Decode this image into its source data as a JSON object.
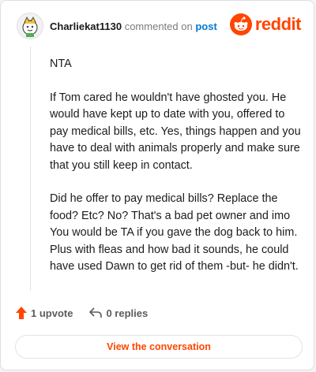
{
  "comment": {
    "username": "Charliekat1130",
    "action_text": "commented on",
    "link_text": "post",
    "paragraphs": [
      "NTA",
      "If Tom cared he wouldn't have ghosted you. He would have kept up to date with you, offered to pay medical bills, etc. Yes, things happen and you have to deal with animals properly and make sure that you still keep in contact.",
      "Did he offer to pay medical bills? Replace the food? Etc? No? That's a bad pet owner and imo You would be TA if you gave the dog back to him. Plus with fleas and how bad it sounds, he could have used Dawn to get rid of them -but- he didn't."
    ]
  },
  "brand": {
    "wordmark": "reddit",
    "color": "#ff4500",
    "icon": "reddit-snoo-icon"
  },
  "footer": {
    "upvotes": "1 upvote",
    "upvote_icon": "upvote-arrow-icon",
    "replies": "0 replies",
    "reply_icon": "reply-arrow-icon"
  },
  "cta": {
    "label": "View the conversation"
  },
  "colors": {
    "accent": "#ff4500",
    "link": "#0079d3",
    "text": "#1c1c1c",
    "muted": "#7c7c7c"
  }
}
